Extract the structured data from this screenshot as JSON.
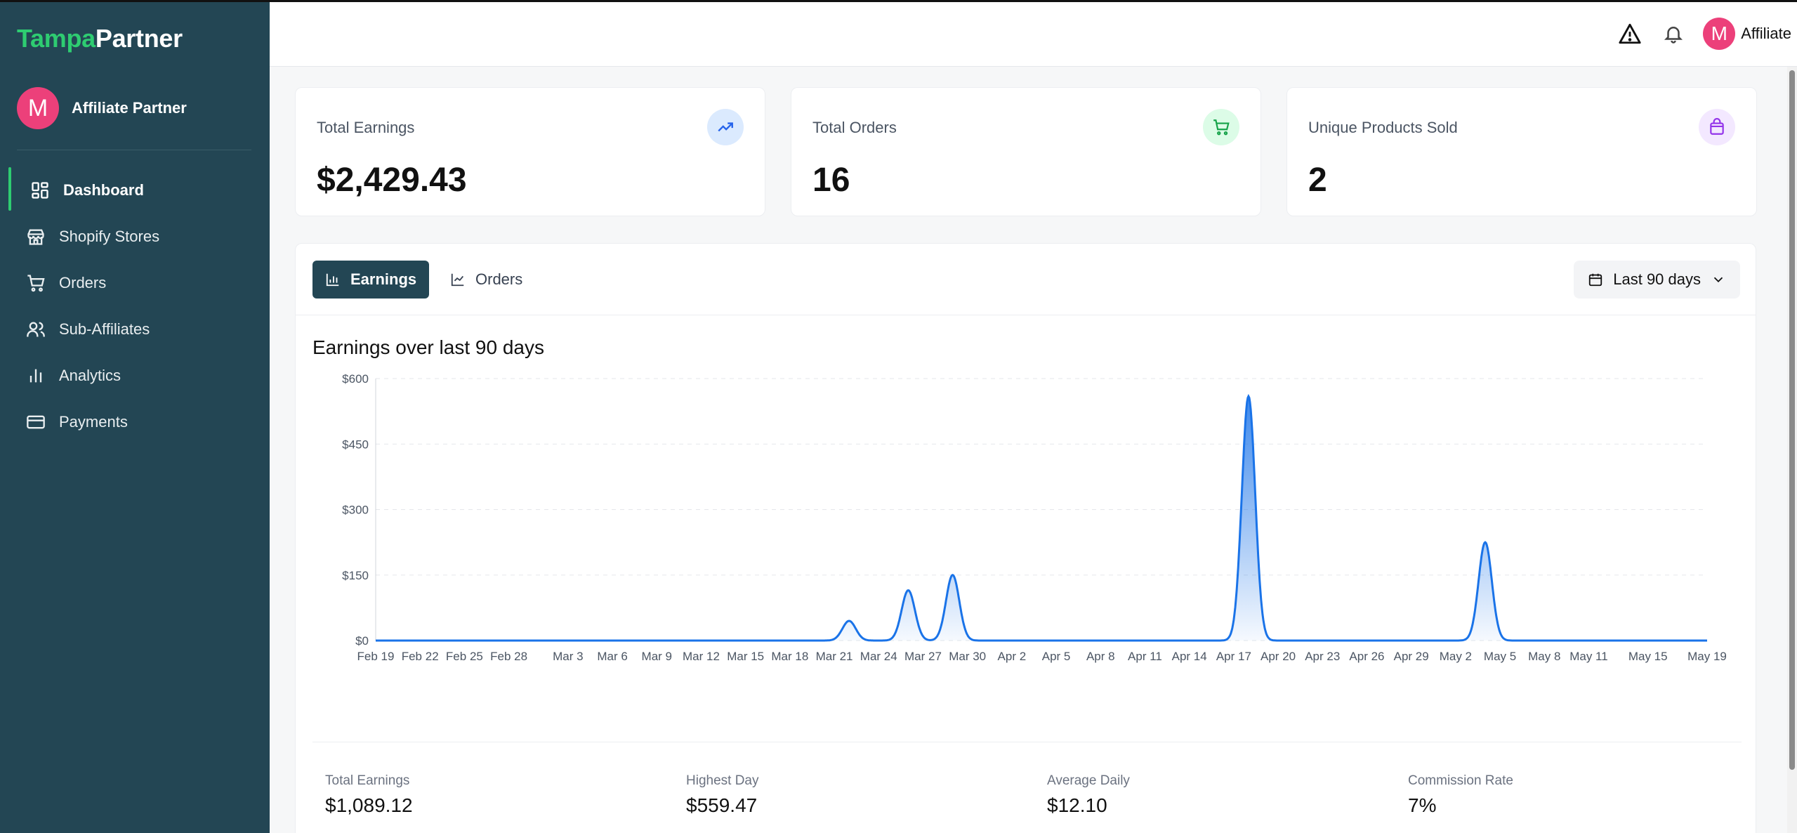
{
  "brand": {
    "part1": "Tampa",
    "part2": "Partner"
  },
  "profile": {
    "initial": "M",
    "name": "Affiliate Partner"
  },
  "nav": [
    {
      "label": "Dashboard",
      "icon": "dashboard-icon",
      "active": true
    },
    {
      "label": "Shopify Stores",
      "icon": "store-icon"
    },
    {
      "label": "Orders",
      "icon": "cart-icon"
    },
    {
      "label": "Sub-Affiliates",
      "icon": "users-icon"
    },
    {
      "label": "Analytics",
      "icon": "bar-chart-icon"
    },
    {
      "label": "Payments",
      "icon": "credit-card-icon"
    }
  ],
  "header": {
    "initial": "M",
    "user": "Affiliate"
  },
  "stats": [
    {
      "label": "Total Earnings",
      "value": "$2,429.43",
      "icon": "trending-up-icon",
      "icon_bg": "#dbeafe",
      "icon_color": "#2563eb"
    },
    {
      "label": "Total Orders",
      "value": "16",
      "icon": "cart-icon",
      "icon_bg": "#dcfce7",
      "icon_color": "#16a34a"
    },
    {
      "label": "Unique Products Sold",
      "value": "2",
      "icon": "package-icon",
      "icon_bg": "#f3e8ff",
      "icon_color": "#9333ea"
    }
  ],
  "tabs": {
    "earnings": "Earnings",
    "orders": "Orders"
  },
  "range": "Last 90 days",
  "chart_title": "Earnings over last 90 days",
  "chart_data": {
    "type": "area",
    "yticks": [
      "$0",
      "$150",
      "$300",
      "$450",
      "$600"
    ],
    "ylim": [
      0,
      600
    ],
    "xticks": [
      "Feb 19",
      "Feb 22",
      "Feb 25",
      "Feb 28",
      "Mar 3",
      "Mar 6",
      "Mar 9",
      "Mar 12",
      "Mar 15",
      "Mar 18",
      "Mar 21",
      "Mar 24",
      "Mar 27",
      "Mar 30",
      "Apr 2",
      "Apr 5",
      "Apr 8",
      "Apr 11",
      "Apr 14",
      "Apr 17",
      "Apr 20",
      "Apr 23",
      "Apr 26",
      "Apr 29",
      "May 2",
      "May 5",
      "May 8",
      "May 11",
      "May 15",
      "May 19"
    ],
    "series": [
      {
        "points": [
          {
            "x": "Feb 19",
            "y": 0
          },
          {
            "x": "Mar 22",
            "y": 45
          },
          {
            "x": "Mar 26",
            "y": 115
          },
          {
            "x": "Mar 29",
            "y": 150
          },
          {
            "x": "Apr 18",
            "y": 559.47
          },
          {
            "x": "May 4",
            "y": 225
          },
          {
            "x": "May 19",
            "y": 0
          }
        ]
      }
    ],
    "grid": true,
    "color": "#1a73e8"
  },
  "summary": [
    {
      "label": "Total Earnings",
      "value": "$1,089.12"
    },
    {
      "label": "Highest Day",
      "value": "$559.47"
    },
    {
      "label": "Average Daily",
      "value": "$12.10"
    },
    {
      "label": "Commission Rate",
      "value": "7%"
    }
  ]
}
